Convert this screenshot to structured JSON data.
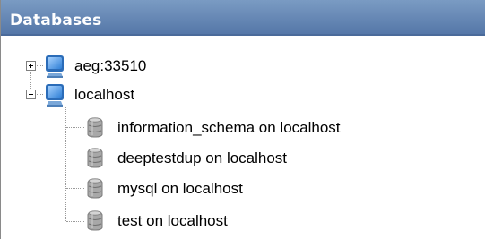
{
  "header": {
    "title": "Databases"
  },
  "tree": {
    "servers": [
      {
        "label": "aeg:33510",
        "expanded": false,
        "icon": "server-icon"
      },
      {
        "label": "localhost",
        "expanded": true,
        "icon": "server-icon",
        "databases": [
          {
            "label": "information_schema on localhost",
            "icon": "database-icon"
          },
          {
            "label": "deeptestdup on localhost",
            "icon": "database-icon"
          },
          {
            "label": "mysql on localhost",
            "icon": "database-icon"
          },
          {
            "label": "test on localhost",
            "icon": "database-icon"
          }
        ]
      }
    ]
  },
  "colors": {
    "header_bg": "#6688b5",
    "header_text": "#ffffff",
    "tree_lines": "#9a9a9a",
    "server_icon": "#3f8ed8",
    "database_icon": "#9c9c9c"
  }
}
